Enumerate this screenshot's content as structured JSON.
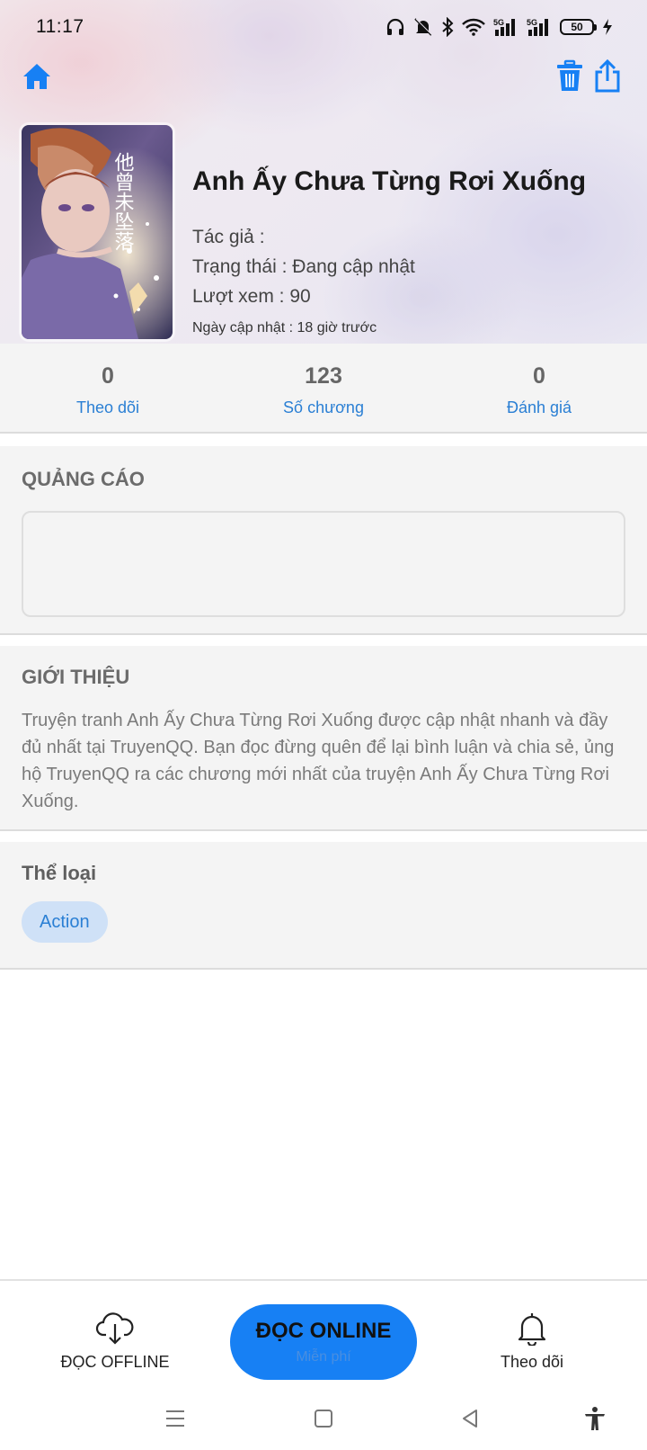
{
  "status_bar": {
    "time": "11:17",
    "battery": "50",
    "network_1": "5G",
    "network_2": "5G"
  },
  "header": {
    "home_icon": "home-icon",
    "delete_icon": "trash-icon",
    "share_icon": "share-icon",
    "accent_color": "#1780f4"
  },
  "comic": {
    "title": "Anh Ấy Chưa Từng Rơi Xuống",
    "author_line": "Tác giả :",
    "status_line": "Trạng thái : Đang cập nhật",
    "views_line": "Lượt xem : 90",
    "updated_line": "Ngày cập nhật : 18 giờ trước",
    "cover_text": "他曾未坠落"
  },
  "stats": [
    {
      "value": "0",
      "label": "Theo dõi"
    },
    {
      "value": "123",
      "label": "Số chương"
    },
    {
      "value": "0",
      "label": "Đánh giá"
    }
  ],
  "ads": {
    "title": "QUẢNG CÁO"
  },
  "intro": {
    "title": "GIỚI THIỆU",
    "text": "Truyện tranh Anh Ấy Chưa Từng Rơi Xuống được cập nhật nhanh và đầy đủ nhất tại TruyenQQ. Bạn đọc đừng quên để lại bình luận và chia sẻ, ủng hộ TruyenQQ ra các chương mới nhất của truyện Anh Ấy Chưa Từng Rơi Xuống."
  },
  "genre": {
    "title": "Thể loại",
    "tags": [
      "Action"
    ]
  },
  "bottom_bar": {
    "offline_label": "ĐỌC OFFLINE",
    "online_label": "ĐỌC ONLINE",
    "online_sub": "Miễn phí",
    "follow_label": "Theo dõi"
  }
}
